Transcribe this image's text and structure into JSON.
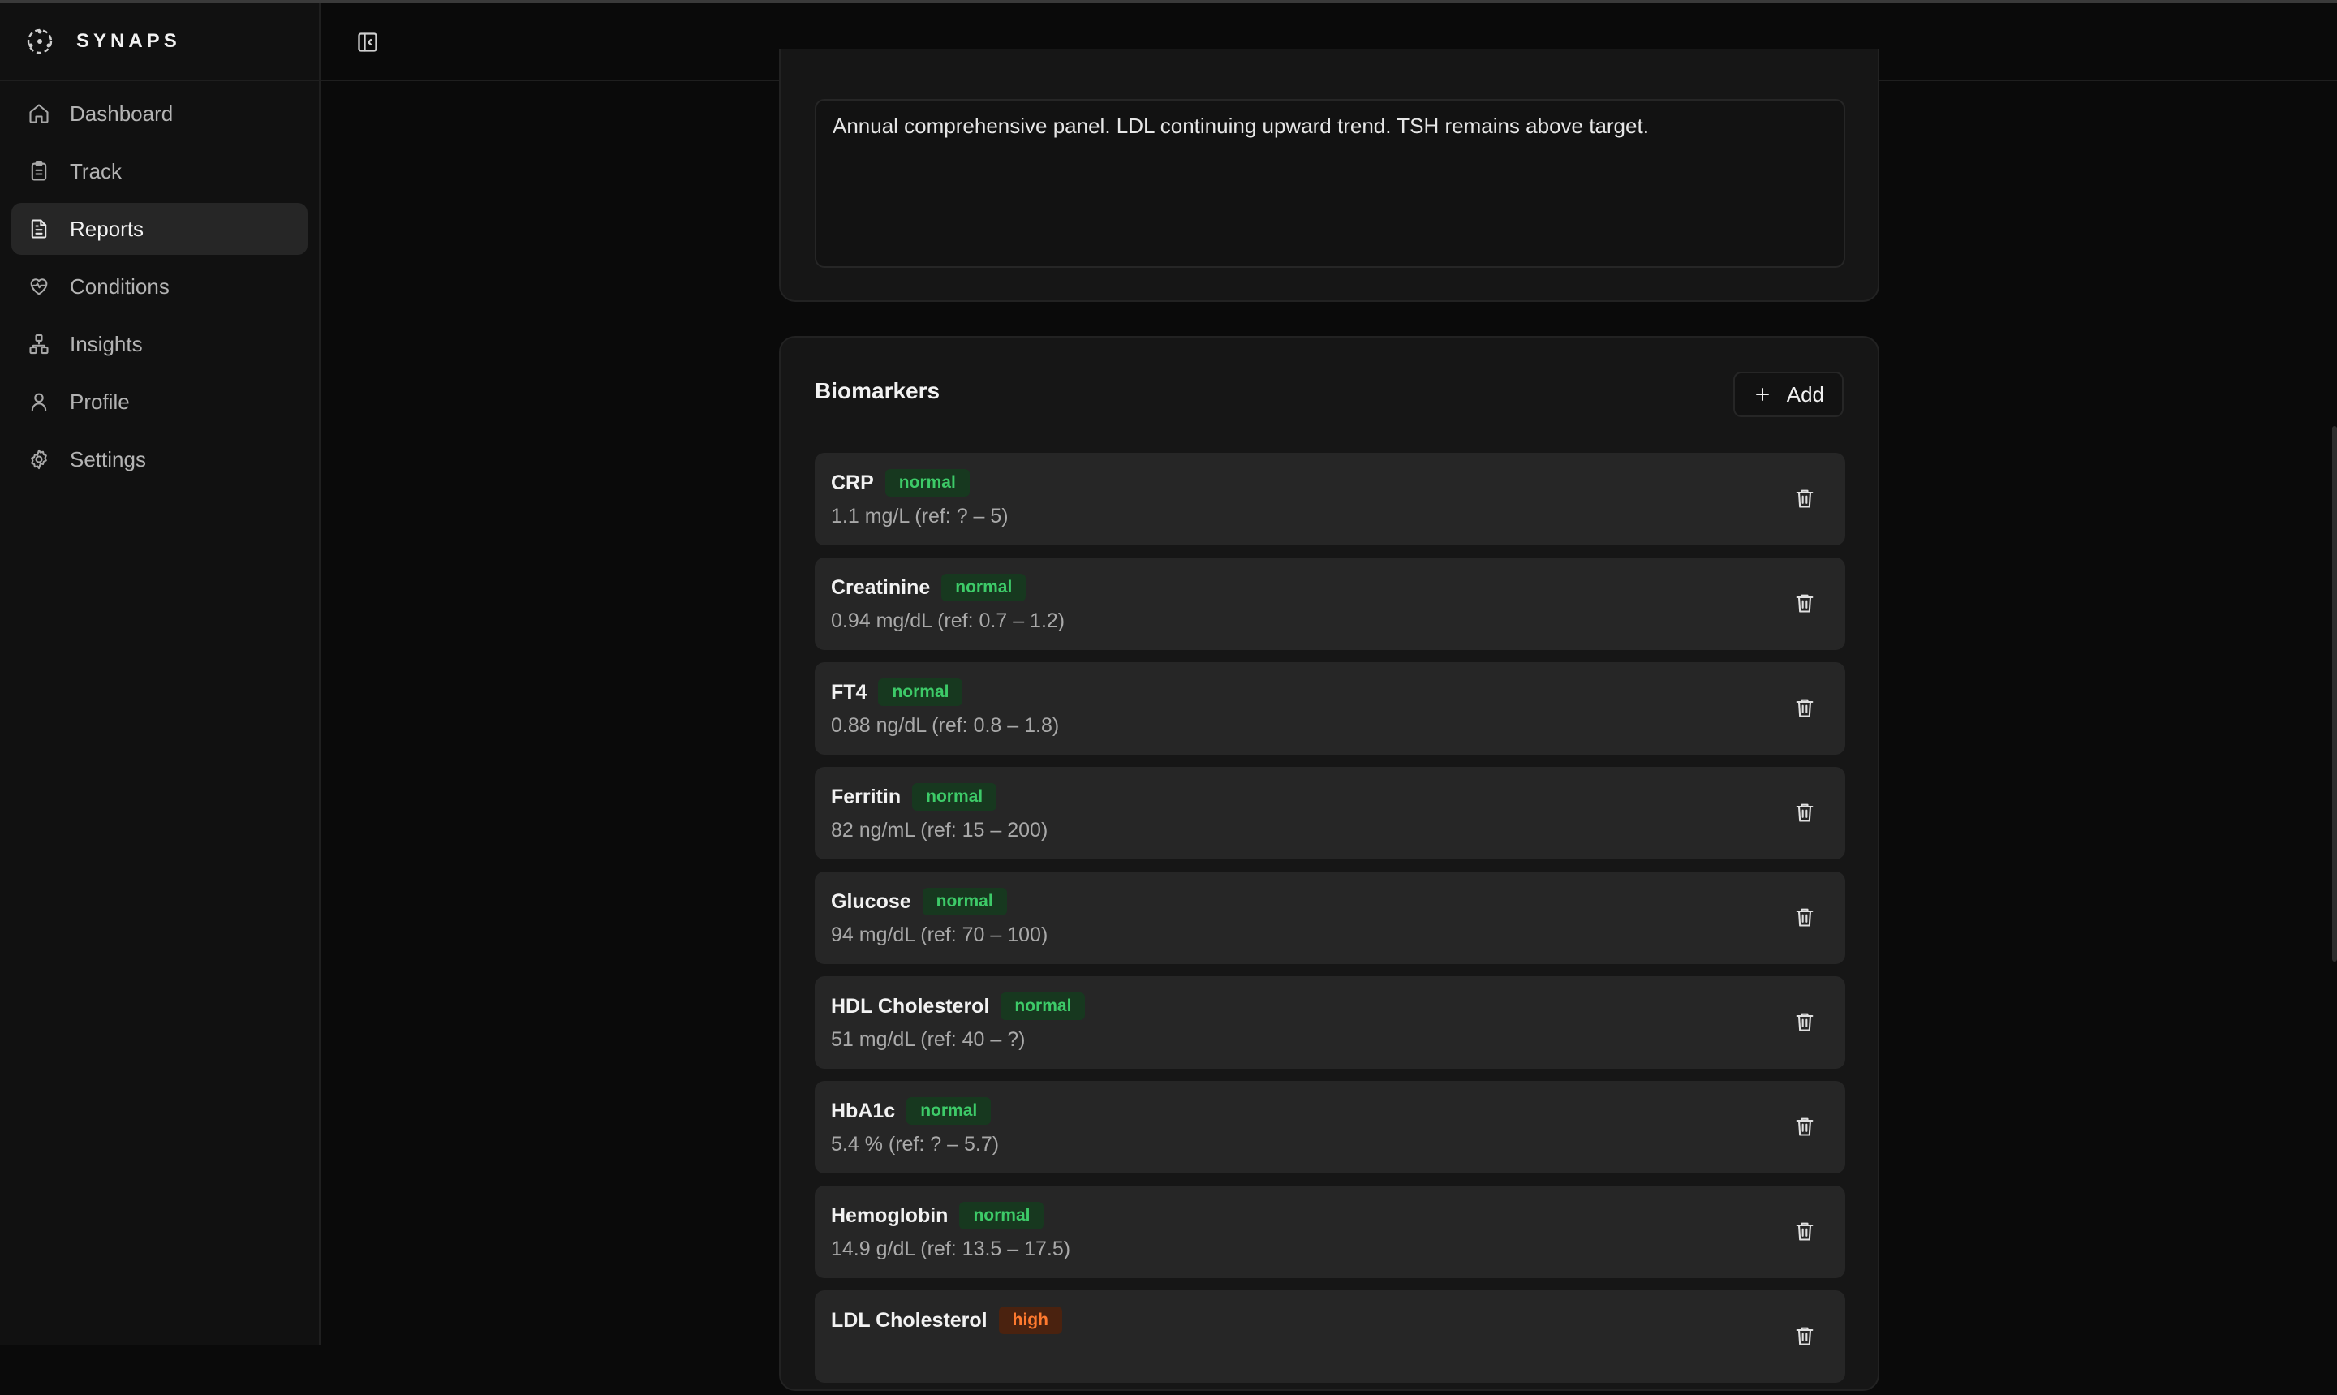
{
  "app": {
    "name": "SYNAPS"
  },
  "sidebar": {
    "items": [
      {
        "label": "Dashboard",
        "icon": "home-icon"
      },
      {
        "label": "Track",
        "icon": "clipboard-icon"
      },
      {
        "label": "Reports",
        "icon": "file-text-icon",
        "active": true
      },
      {
        "label": "Conditions",
        "icon": "heart-pulse-icon"
      },
      {
        "label": "Insights",
        "icon": "network-icon"
      },
      {
        "label": "Profile",
        "icon": "user-icon"
      },
      {
        "label": "Settings",
        "icon": "gear-icon"
      }
    ]
  },
  "notes": {
    "text": "Annual comprehensive panel. LDL continuing upward trend. TSH remains above target."
  },
  "biomarkers": {
    "title": "Biomarkers",
    "add_label": "Add",
    "items": [
      {
        "name": "CRP",
        "status": "normal",
        "value": "1.1 mg/L (ref: ? – 5)"
      },
      {
        "name": "Creatinine",
        "status": "normal",
        "value": "0.94 mg/dL (ref: 0.7 – 1.2)"
      },
      {
        "name": "FT4",
        "status": "normal",
        "value": "0.88 ng/dL (ref: 0.8 – 1.8)"
      },
      {
        "name": "Ferritin",
        "status": "normal",
        "value": "82 ng/mL (ref: 15 – 200)"
      },
      {
        "name": "Glucose",
        "status": "normal",
        "value": "94 mg/dL (ref: 70 – 100)"
      },
      {
        "name": "HDL Cholesterol",
        "status": "normal",
        "value": "51 mg/dL (ref: 40 – ?)"
      },
      {
        "name": "HbA1c",
        "status": "normal",
        "value": "5.4 % (ref: ? – 5.7)"
      },
      {
        "name": "Hemoglobin",
        "status": "normal",
        "value": "14.9 g/dL (ref: 13.5 – 17.5)"
      },
      {
        "name": "LDL Cholesterol",
        "status": "high",
        "value": ""
      }
    ]
  },
  "colors": {
    "normal_text": "#3dca68",
    "normal_bg": "#17381f",
    "high_text": "#ff7a2f",
    "high_bg": "#4a220f"
  }
}
